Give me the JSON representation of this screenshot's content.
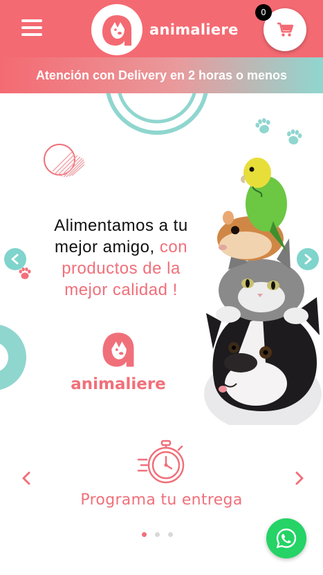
{
  "header": {
    "brand": "animaliere",
    "cart_count": "0",
    "colors": {
      "primary": "#f46a72",
      "accent": "#7fd4cc"
    }
  },
  "banner": {
    "text": "Atención con Delivery en 2 horas o menos"
  },
  "hero": {
    "title_line_1": "Alimentamos a tu",
    "title_line_2_a": "mejor amigo, ",
    "title_line_2_b": "con",
    "title_line_3": "productos de la",
    "title_line_4": "mejor calidad !",
    "brand": "animaliere",
    "icons": [
      "chevron-left-icon",
      "chevron-right-icon",
      "paw-icon"
    ]
  },
  "feature": {
    "title": "Programa tu entrega",
    "icon": "stopwatch-icon",
    "slides": 3,
    "active_slide": 1
  },
  "whatsapp": {
    "icon": "whatsapp-icon",
    "color": "#25d366"
  }
}
